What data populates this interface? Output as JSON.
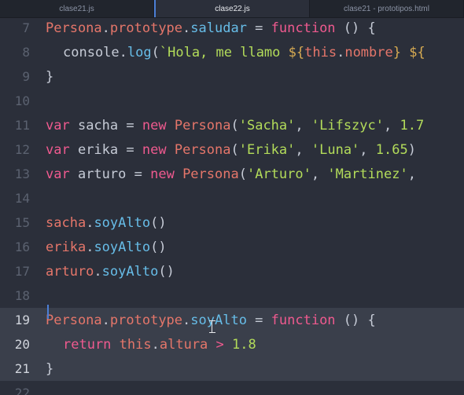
{
  "tabs": [
    {
      "label": "clase21.js",
      "active": false
    },
    {
      "label": "clase22.js",
      "active": true
    },
    {
      "label": "clase21 - prototipos.html",
      "active": false
    }
  ],
  "lines": [
    {
      "num": "7",
      "indent": 0,
      "tokens": [
        [
          "cls",
          "Persona"
        ],
        [
          "punc",
          "."
        ],
        [
          "prop",
          "prototype"
        ],
        [
          "punc",
          "."
        ],
        [
          "fn",
          "saludar"
        ],
        [
          "punc",
          " = "
        ],
        [
          "kw",
          "function"
        ],
        [
          "punc",
          " () {"
        ]
      ]
    },
    {
      "num": "8",
      "indent": 1,
      "tokens": [
        [
          "var",
          "console"
        ],
        [
          "punc",
          "."
        ],
        [
          "fn",
          "log"
        ],
        [
          "punc",
          "("
        ],
        [
          "str",
          "`Hola, me llamo "
        ],
        [
          "tpl",
          "${"
        ],
        [
          "prop",
          "this"
        ],
        [
          "punc",
          "."
        ],
        [
          "prop",
          "nombre"
        ],
        [
          "tpl",
          "}"
        ],
        [
          "str",
          " "
        ],
        [
          "tpl",
          "${"
        ]
      ]
    },
    {
      "num": "9",
      "indent": 0,
      "tokens": [
        [
          "punc",
          "}"
        ]
      ]
    },
    {
      "num": "10",
      "indent": 0,
      "tokens": []
    },
    {
      "num": "11",
      "indent": 0,
      "tokens": [
        [
          "kw",
          "var"
        ],
        [
          "var",
          " sacha "
        ],
        [
          "punc",
          "= "
        ],
        [
          "kw",
          "new"
        ],
        [
          "punc",
          " "
        ],
        [
          "cls",
          "Persona"
        ],
        [
          "punc",
          "("
        ],
        [
          "str",
          "'Sacha'"
        ],
        [
          "punc",
          ", "
        ],
        [
          "str",
          "'Lifszyc'"
        ],
        [
          "punc",
          ", "
        ],
        [
          "num",
          "1.7"
        ]
      ]
    },
    {
      "num": "12",
      "indent": 0,
      "tokens": [
        [
          "kw",
          "var"
        ],
        [
          "var",
          " erika "
        ],
        [
          "punc",
          "= "
        ],
        [
          "kw",
          "new"
        ],
        [
          "punc",
          " "
        ],
        [
          "cls",
          "Persona"
        ],
        [
          "punc",
          "("
        ],
        [
          "str",
          "'Erika'"
        ],
        [
          "punc",
          ", "
        ],
        [
          "str",
          "'Luna'"
        ],
        [
          "punc",
          ", "
        ],
        [
          "num",
          "1.65"
        ],
        [
          "punc",
          ")"
        ]
      ]
    },
    {
      "num": "13",
      "indent": 0,
      "tokens": [
        [
          "kw",
          "var"
        ],
        [
          "var",
          " arturo "
        ],
        [
          "punc",
          "= "
        ],
        [
          "kw",
          "new"
        ],
        [
          "punc",
          " "
        ],
        [
          "cls",
          "Persona"
        ],
        [
          "punc",
          "("
        ],
        [
          "str",
          "'Arturo'"
        ],
        [
          "punc",
          ", "
        ],
        [
          "str",
          "'Martinez'"
        ],
        [
          "punc",
          ","
        ]
      ]
    },
    {
      "num": "14",
      "indent": 0,
      "tokens": []
    },
    {
      "num": "15",
      "indent": 0,
      "tokens": [
        [
          "prop",
          "sacha"
        ],
        [
          "punc",
          "."
        ],
        [
          "fn",
          "soyAlto"
        ],
        [
          "punc",
          "()"
        ]
      ]
    },
    {
      "num": "16",
      "indent": 0,
      "tokens": [
        [
          "prop",
          "erika"
        ],
        [
          "punc",
          "."
        ],
        [
          "fn",
          "soyAlto"
        ],
        [
          "punc",
          "()"
        ]
      ]
    },
    {
      "num": "17",
      "indent": 0,
      "tokens": [
        [
          "prop",
          "arturo"
        ],
        [
          "punc",
          "."
        ],
        [
          "fn",
          "soyAlto"
        ],
        [
          "punc",
          "()"
        ]
      ]
    },
    {
      "num": "18",
      "indent": 0,
      "tokens": []
    },
    {
      "num": "19",
      "indent": 0,
      "hl": true,
      "tokens": [
        [
          "cls",
          "Persona"
        ],
        [
          "punc",
          "."
        ],
        [
          "prop",
          "prototype"
        ],
        [
          "punc",
          "."
        ],
        [
          "fn",
          "soyAlto"
        ],
        [
          "punc",
          " = "
        ],
        [
          "kw",
          "function"
        ],
        [
          "punc",
          " () {"
        ]
      ]
    },
    {
      "num": "20",
      "indent": 1,
      "hl": true,
      "tokens": [
        [
          "kw",
          "return"
        ],
        [
          "punc",
          " "
        ],
        [
          "prop",
          "this"
        ],
        [
          "punc",
          "."
        ],
        [
          "prop",
          "altura"
        ],
        [
          "kw",
          " > "
        ],
        [
          "num",
          "1.8"
        ]
      ]
    },
    {
      "num": "21",
      "indent": 0,
      "hl": true,
      "tokens": [
        [
          "punc",
          "}"
        ]
      ]
    },
    {
      "num": "22",
      "indent": 0,
      "tokens": []
    }
  ]
}
